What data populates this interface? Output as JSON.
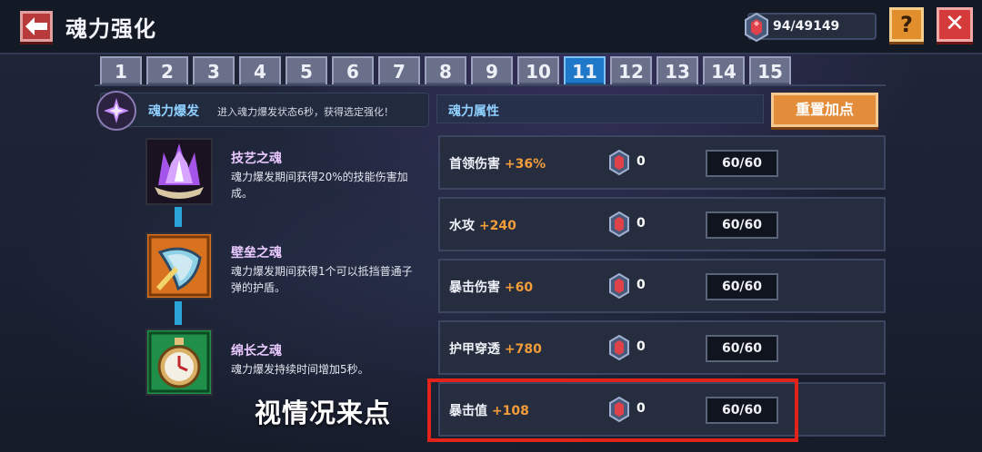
{
  "header": {
    "title": "魂力强化",
    "currency_value": "94/49149",
    "help_label": "?",
    "close_label": "✕"
  },
  "tabs": [
    "1",
    "2",
    "3",
    "4",
    "5",
    "6",
    "7",
    "8",
    "9",
    "10",
    "11",
    "12",
    "13",
    "14",
    "15"
  ],
  "active_tab": "11",
  "burst": {
    "title": "魂力爆发",
    "desc": "进入魂力爆发状态6秒，获得选定强化！"
  },
  "skills": [
    {
      "name": "技艺之魂",
      "desc": "魂力爆发期间获得20%的技能伤害加成。",
      "icon": "crystal-flame-icon"
    },
    {
      "name": "壁垒之魂",
      "desc": "魂力爆发期间获得1个可以抵挡普通子弹的护盾。",
      "icon": "shield-icon"
    },
    {
      "name": "绵长之魂",
      "desc": "魂力爆发持续时间增加5秒。",
      "icon": "stopwatch-icon"
    }
  ],
  "attributes": {
    "header": "魂力属性",
    "reset_label": "重置加点",
    "rows": [
      {
        "name": "首领伤害",
        "bonus": "+36%",
        "cost": "0",
        "level": "60/60"
      },
      {
        "name": "水攻",
        "bonus": "+240",
        "cost": "0",
        "level": "60/60"
      },
      {
        "name": "暴击伤害",
        "bonus": "+60",
        "cost": "0",
        "level": "60/60"
      },
      {
        "name": "护甲穿透",
        "bonus": "+780",
        "cost": "0",
        "level": "60/60"
      },
      {
        "name": "暴击值",
        "bonus": "+108",
        "cost": "0",
        "level": "60/60"
      }
    ]
  },
  "annotation": {
    "text": "视情况来点",
    "highlight_color": "#e2231a"
  },
  "colors": {
    "accent_blue": "#1f78c8",
    "bonus_orange": "#f39c3a",
    "button_orange": "#e38d3b",
    "button_red": "#d63b3b"
  }
}
